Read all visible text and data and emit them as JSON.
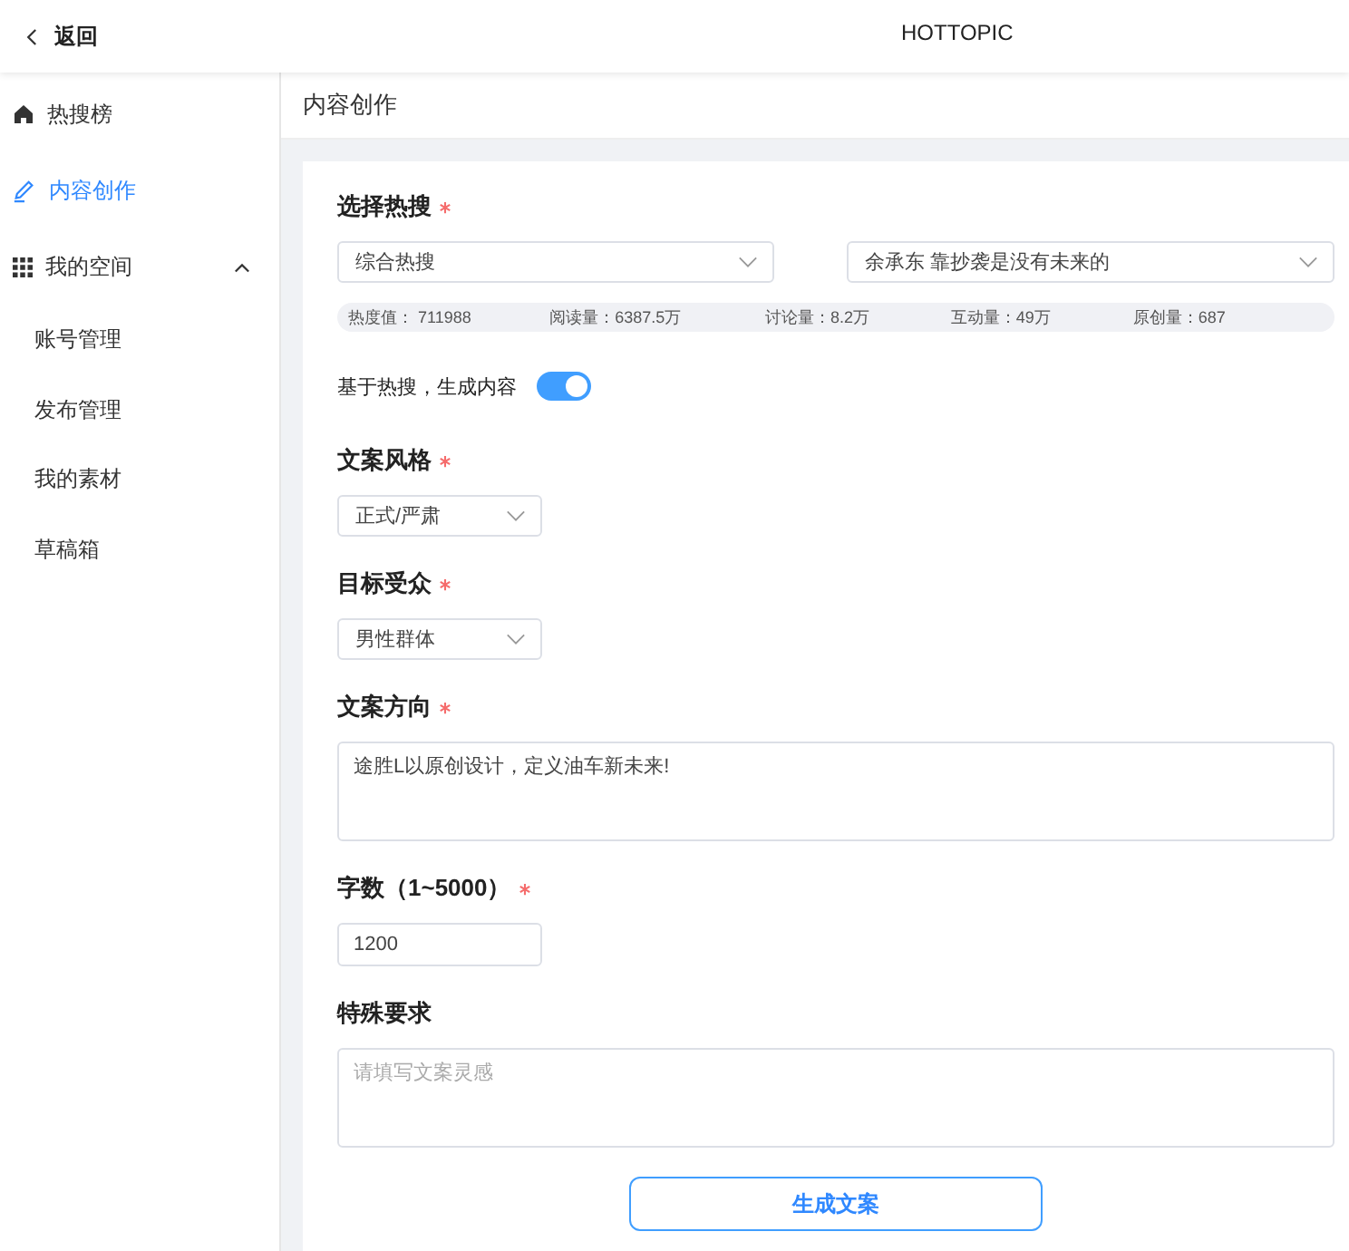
{
  "header": {
    "back_label": "返回",
    "title": "HOTTOPIC"
  },
  "sidebar": {
    "items": [
      {
        "label": "热搜榜",
        "selected": false
      },
      {
        "label": "内容创作",
        "selected": true
      },
      {
        "label": "我的空间",
        "selected": false,
        "expanded": true,
        "children": [
          {
            "label": "账号管理",
            "selected": false
          },
          {
            "label": "发布管理",
            "selected": false
          },
          {
            "label": "我的素材",
            "selected": false
          },
          {
            "label": "草稿箱",
            "selected": false
          }
        ]
      }
    ]
  },
  "page_title": "内容创作",
  "form": [
    {
      "kind": "select_pair",
      "label": "选择热搜",
      "required": true,
      "values": [
        "综合热搜",
        "余承东 靠抄袭是没有未来的"
      ]
    },
    {
      "kind": "stats",
      "items": [
        "热度值： 711988",
        "阅读量：6387.5万",
        "讨论量：8.2万",
        "互动量：49万",
        "原创量：687"
      ]
    },
    {
      "kind": "toggle",
      "label": "基于热搜，生成内容",
      "on": true
    },
    {
      "kind": "select",
      "label": "文案风格",
      "required": true,
      "value": "正式/严肃"
    },
    {
      "kind": "select",
      "label": "目标受众",
      "required": true,
      "value": "男性群体"
    },
    {
      "kind": "textarea",
      "label": "文案方向",
      "required": true,
      "value": "途胜L以原创设计，定义油车新未来!"
    },
    {
      "kind": "input",
      "label": "字数（1~5000）",
      "required": true,
      "value": "1200"
    },
    {
      "kind": "textarea",
      "label": "特殊要求",
      "required": false,
      "placeholder": "请填写文案灵感"
    }
  ],
  "submit_label": "生成文案"
}
